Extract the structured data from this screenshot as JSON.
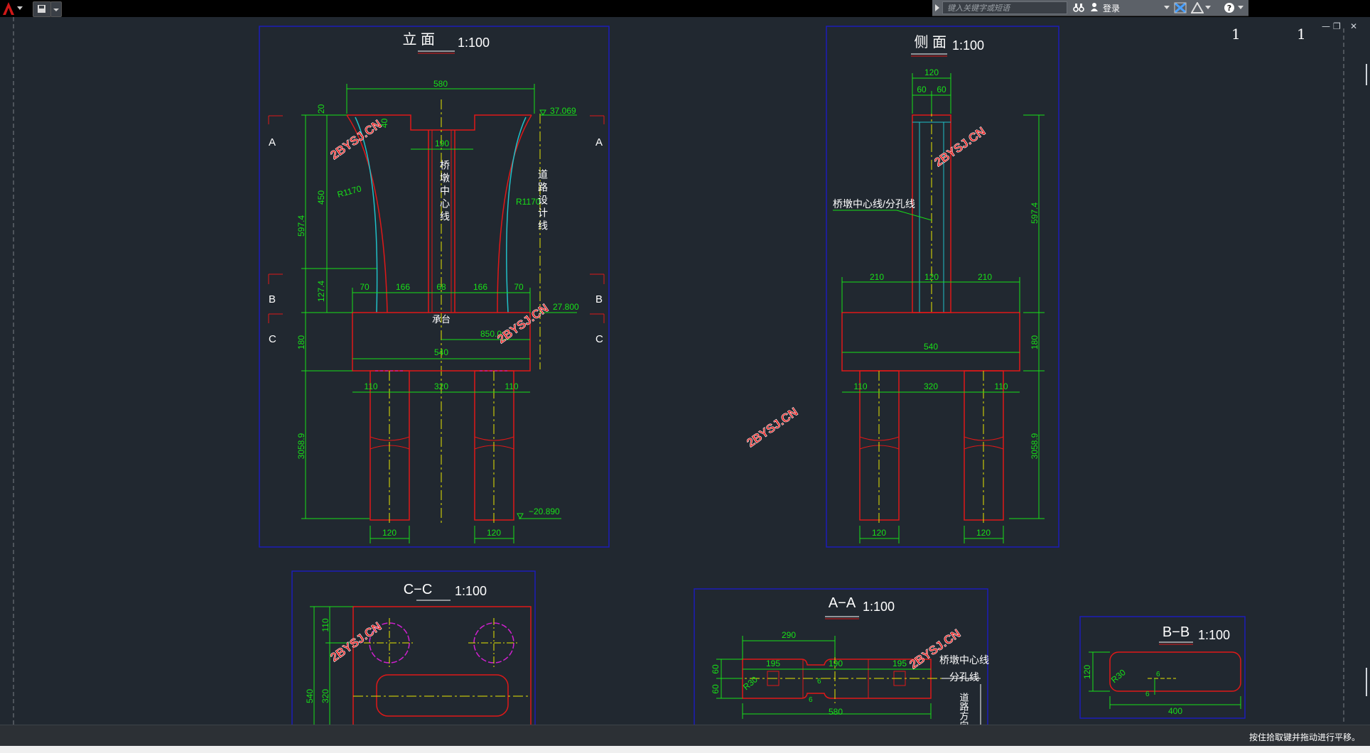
{
  "app": {
    "search_placeholder": "键入关键字或短语",
    "login_label": "登录",
    "status_message": "按住拾取键并拖动进行平移。",
    "viewport_numbers": [
      "1",
      "1"
    ]
  },
  "colors": {
    "background": "#212830",
    "frame_blue": "#1c1cb8",
    "outline_red": "#e01818",
    "dimension_green": "#18e018",
    "centerline_yellow": "#e6e600",
    "curve_cyan": "#20c0c8",
    "pile_magenta": "#d020d0",
    "text_white": "#ffffff",
    "watermark_red": "#e82020"
  },
  "drawing": {
    "elevation": {
      "title": "立 面",
      "scale": "1:100",
      "dims": {
        "top_width": "580",
        "neck_width": "190",
        "d20": "20",
        "d40": "40",
        "h597": "597.4",
        "h450": "450",
        "h127": "127.4",
        "h180": "180",
        "h3058": "3058.9",
        "r1": "R1170",
        "r2": "R1170",
        "d70a": "70",
        "d166a": "166",
        "d68": "68",
        "d166b": "166",
        "d70b": "70",
        "d850": "850.0",
        "d540": "540",
        "d110a": "110",
        "d320": "320",
        "d110b": "110",
        "p120a": "120",
        "p120b": "120",
        "elev_top": "37.069",
        "elev_mid": "27.800",
        "elev_bot": "−20.890"
      },
      "labels": {
        "center": "桥墩中心线",
        "road": "道路设计线",
        "cap": "承台",
        "a": "A",
        "b": "B",
        "c": "C"
      }
    },
    "side": {
      "title": "侧 面",
      "scale": "1:100",
      "dims": {
        "w120": "120",
        "w60a": "60",
        "w60b": "60",
        "h597": "597.4",
        "d210a": "210",
        "d120": "120",
        "d210b": "210",
        "d540": "540",
        "h180": "180",
        "d110a": "110",
        "d320": "320",
        "d110b": "110",
        "h3058": "3058.9",
        "p120a": "120",
        "p120b": "120"
      },
      "labels": {
        "center": "桥墩中心线/分孔线"
      }
    },
    "cc": {
      "title": "C−C",
      "scale": "1:100",
      "dims": {
        "d110": "110",
        "d540": "540",
        "d320": "320"
      }
    },
    "aa": {
      "title": "A−A",
      "scale": "1:100",
      "dims": {
        "d290": "290",
        "d195a": "195",
        "d190": "190",
        "d195b": "195",
        "d60a": "60",
        "d60b": "60",
        "d580": "580",
        "r30": "R30",
        "d6a": "6",
        "d6b": "6"
      },
      "labels": {
        "center": "桥墩中心线",
        "span": "分孔线",
        "road": "道路方向"
      }
    },
    "bb": {
      "title": "B−B",
      "scale": "1:100",
      "dims": {
        "d120": "120",
        "r30": "R30",
        "d6a": "6",
        "d6b": "6",
        "d400": "400"
      }
    },
    "watermark": "2BYSJ.CN"
  }
}
